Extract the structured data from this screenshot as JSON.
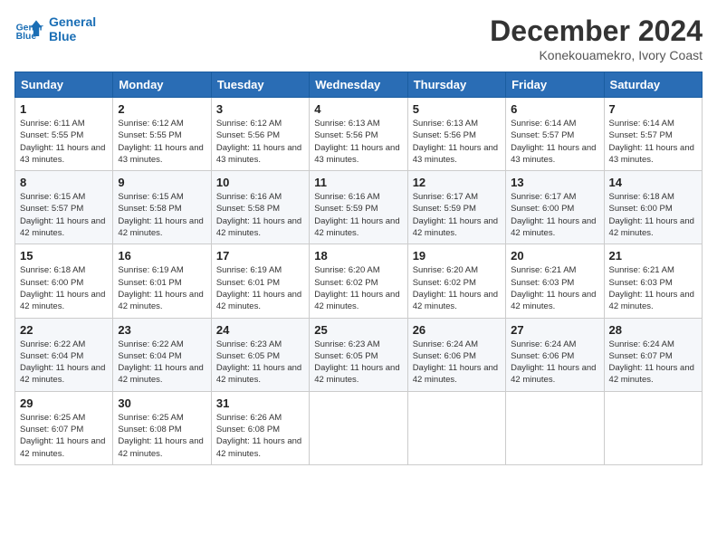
{
  "logo": {
    "line1": "General",
    "line2": "Blue"
  },
  "header": {
    "month": "December 2024",
    "location": "Konekouamekro, Ivory Coast"
  },
  "weekdays": [
    "Sunday",
    "Monday",
    "Tuesday",
    "Wednesday",
    "Thursday",
    "Friday",
    "Saturday"
  ],
  "weeks": [
    [
      {
        "day": 1,
        "sunrise": "6:11 AM",
        "sunset": "5:55 PM",
        "daylight": "11 hours and 43 minutes."
      },
      {
        "day": 2,
        "sunrise": "6:12 AM",
        "sunset": "5:55 PM",
        "daylight": "11 hours and 43 minutes."
      },
      {
        "day": 3,
        "sunrise": "6:12 AM",
        "sunset": "5:56 PM",
        "daylight": "11 hours and 43 minutes."
      },
      {
        "day": 4,
        "sunrise": "6:13 AM",
        "sunset": "5:56 PM",
        "daylight": "11 hours and 43 minutes."
      },
      {
        "day": 5,
        "sunrise": "6:13 AM",
        "sunset": "5:56 PM",
        "daylight": "11 hours and 43 minutes."
      },
      {
        "day": 6,
        "sunrise": "6:14 AM",
        "sunset": "5:57 PM",
        "daylight": "11 hours and 43 minutes."
      },
      {
        "day": 7,
        "sunrise": "6:14 AM",
        "sunset": "5:57 PM",
        "daylight": "11 hours and 43 minutes."
      }
    ],
    [
      {
        "day": 8,
        "sunrise": "6:15 AM",
        "sunset": "5:57 PM",
        "daylight": "11 hours and 42 minutes."
      },
      {
        "day": 9,
        "sunrise": "6:15 AM",
        "sunset": "5:58 PM",
        "daylight": "11 hours and 42 minutes."
      },
      {
        "day": 10,
        "sunrise": "6:16 AM",
        "sunset": "5:58 PM",
        "daylight": "11 hours and 42 minutes."
      },
      {
        "day": 11,
        "sunrise": "6:16 AM",
        "sunset": "5:59 PM",
        "daylight": "11 hours and 42 minutes."
      },
      {
        "day": 12,
        "sunrise": "6:17 AM",
        "sunset": "5:59 PM",
        "daylight": "11 hours and 42 minutes."
      },
      {
        "day": 13,
        "sunrise": "6:17 AM",
        "sunset": "6:00 PM",
        "daylight": "11 hours and 42 minutes."
      },
      {
        "day": 14,
        "sunrise": "6:18 AM",
        "sunset": "6:00 PM",
        "daylight": "11 hours and 42 minutes."
      }
    ],
    [
      {
        "day": 15,
        "sunrise": "6:18 AM",
        "sunset": "6:00 PM",
        "daylight": "11 hours and 42 minutes."
      },
      {
        "day": 16,
        "sunrise": "6:19 AM",
        "sunset": "6:01 PM",
        "daylight": "11 hours and 42 minutes."
      },
      {
        "day": 17,
        "sunrise": "6:19 AM",
        "sunset": "6:01 PM",
        "daylight": "11 hours and 42 minutes."
      },
      {
        "day": 18,
        "sunrise": "6:20 AM",
        "sunset": "6:02 PM",
        "daylight": "11 hours and 42 minutes."
      },
      {
        "day": 19,
        "sunrise": "6:20 AM",
        "sunset": "6:02 PM",
        "daylight": "11 hours and 42 minutes."
      },
      {
        "day": 20,
        "sunrise": "6:21 AM",
        "sunset": "6:03 PM",
        "daylight": "11 hours and 42 minutes."
      },
      {
        "day": 21,
        "sunrise": "6:21 AM",
        "sunset": "6:03 PM",
        "daylight": "11 hours and 42 minutes."
      }
    ],
    [
      {
        "day": 22,
        "sunrise": "6:22 AM",
        "sunset": "6:04 PM",
        "daylight": "11 hours and 42 minutes."
      },
      {
        "day": 23,
        "sunrise": "6:22 AM",
        "sunset": "6:04 PM",
        "daylight": "11 hours and 42 minutes."
      },
      {
        "day": 24,
        "sunrise": "6:23 AM",
        "sunset": "6:05 PM",
        "daylight": "11 hours and 42 minutes."
      },
      {
        "day": 25,
        "sunrise": "6:23 AM",
        "sunset": "6:05 PM",
        "daylight": "11 hours and 42 minutes."
      },
      {
        "day": 26,
        "sunrise": "6:24 AM",
        "sunset": "6:06 PM",
        "daylight": "11 hours and 42 minutes."
      },
      {
        "day": 27,
        "sunrise": "6:24 AM",
        "sunset": "6:06 PM",
        "daylight": "11 hours and 42 minutes."
      },
      {
        "day": 28,
        "sunrise": "6:24 AM",
        "sunset": "6:07 PM",
        "daylight": "11 hours and 42 minutes."
      }
    ],
    [
      {
        "day": 29,
        "sunrise": "6:25 AM",
        "sunset": "6:07 PM",
        "daylight": "11 hours and 42 minutes."
      },
      {
        "day": 30,
        "sunrise": "6:25 AM",
        "sunset": "6:08 PM",
        "daylight": "11 hours and 42 minutes."
      },
      {
        "day": 31,
        "sunrise": "6:26 AM",
        "sunset": "6:08 PM",
        "daylight": "11 hours and 42 minutes."
      },
      null,
      null,
      null,
      null
    ]
  ]
}
